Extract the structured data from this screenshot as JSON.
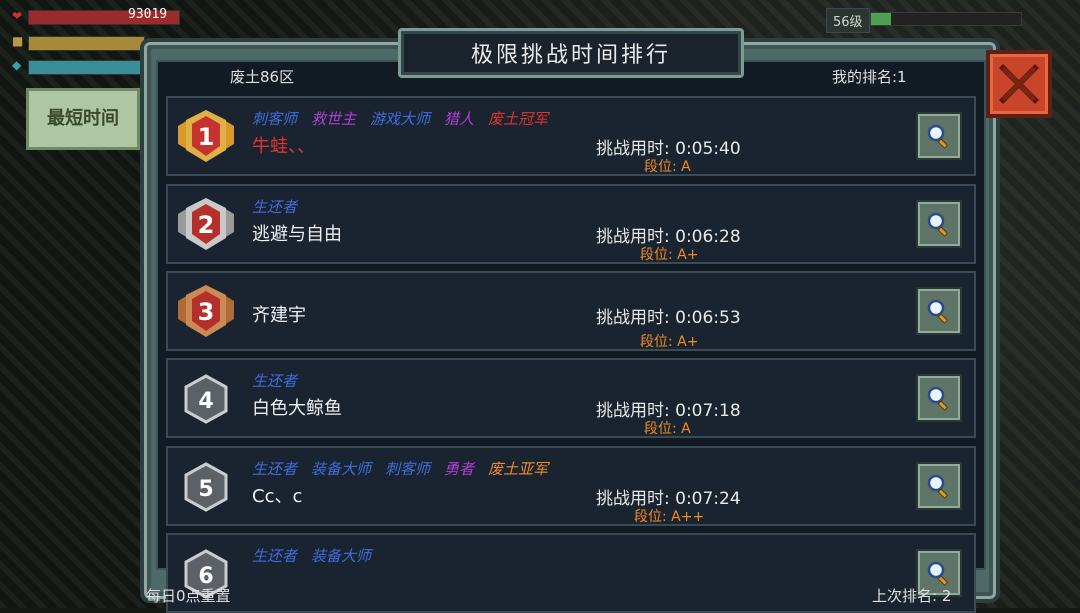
{
  "hud": {
    "hp_value": "93019",
    "level_badge": "56级"
  },
  "side_tab": {
    "label": "最短时间"
  },
  "panel": {
    "title": "极限挑战时间排行",
    "server": "废土86区",
    "my_rank": "我的排名:1",
    "daily_reset": "每日0点重置",
    "last_rank": "上次排名: 2"
  },
  "title_colors": {
    "blue": "#3f6be0",
    "purple": "#b03fd6",
    "red": "#e0332b",
    "orange": "#f08a24"
  },
  "rows": [
    {
      "rank": "1",
      "titles": [
        {
          "text": "刺客师",
          "color": "blue"
        },
        {
          "text": "救世主",
          "color": "purple"
        },
        {
          "text": "游戏大师",
          "color": "blue"
        },
        {
          "text": "猎人",
          "color": "purple"
        },
        {
          "text": "废土冠军",
          "color": "red"
        }
      ],
      "name": "牛蛙、、",
      "time": "挑战用时: 0:05:40",
      "grade": "段位: A"
    },
    {
      "rank": "2",
      "titles": [
        {
          "text": "生还者",
          "color": "blue"
        }
      ],
      "name": "逃避与自由",
      "time": "挑战用时: 0:06:28",
      "grade": "段位: A+"
    },
    {
      "rank": "3",
      "titles": [],
      "name": "齐建宇",
      "time": "挑战用时: 0:06:53",
      "grade": "段位: A+"
    },
    {
      "rank": "4",
      "titles": [
        {
          "text": "生还者",
          "color": "blue"
        }
      ],
      "name": "白色大鲸鱼",
      "time": "挑战用时: 0:07:18",
      "grade": "段位: A"
    },
    {
      "rank": "5",
      "titles": [
        {
          "text": "生还者",
          "color": "blue"
        },
        {
          "text": "装备大师",
          "color": "blue"
        },
        {
          "text": "刺客师",
          "color": "blue"
        },
        {
          "text": "勇者",
          "color": "purple"
        },
        {
          "text": "废土亚军",
          "color": "orange"
        }
      ],
      "name": "Cc、c",
      "time": "挑战用时: 0:07:24",
      "grade": "段位: A++"
    },
    {
      "rank": "6",
      "titles": [
        {
          "text": "生还者",
          "color": "blue"
        },
        {
          "text": "装备大师",
          "color": "blue"
        }
      ],
      "name": "",
      "time": "",
      "grade": ""
    }
  ]
}
